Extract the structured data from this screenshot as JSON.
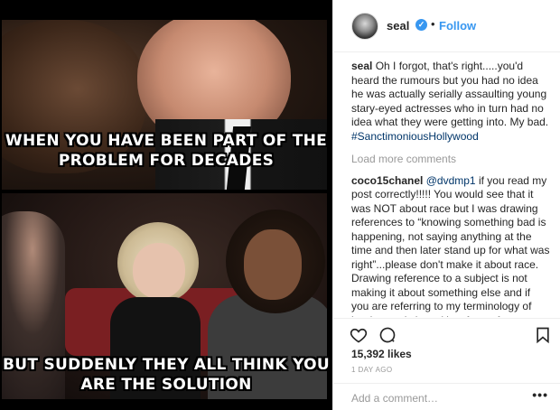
{
  "media": {
    "caption_top": "WHEN YOU HAVE BEEN PART OF THE PROBLEM FOR DECADES",
    "caption_bottom": "BUT SUDDENLY THEY ALL THINK YOU ARE THE SOLUTION"
  },
  "header": {
    "username": "seal",
    "verified_mark": "✓",
    "separator": "•",
    "follow_label": "Follow"
  },
  "comments": [
    {
      "user": "seal",
      "text": "Oh I forgot, that's right.....you'd heard the rumours but you had no idea he was actually serially assaulting young stary-eyed actresses who in turn had no idea what they were getting into. My bad.",
      "hashtag": "#SanctimoniousHollywood"
    },
    {
      "user": "coco15chanel",
      "mention": "@dvdmp1",
      "text": "if you read my post correctly!!!!! You would see that it was NOT about race but I was drawing references to “knowing something bad is happening, not saying anything at the time and then later stand up for what was right”...please don't make it about race. Drawing reference to a subject is not making it about something else and if you are referring to my terminology of brother and sister, it's a form of endearment...please read AGAIN!!!"
    }
  ],
  "load_more_label": "Load more comments",
  "actions": {
    "like_icon": "heart-icon",
    "comment_icon": "comment-bubble-icon",
    "save_icon": "bookmark-icon"
  },
  "likes": "15,392 likes",
  "time_ago": "1 DAY AGO",
  "add_comment_placeholder": "Add a comment…",
  "more_label": "•••",
  "colors": {
    "link_blue": "#3897f0",
    "hashtag_blue": "#003569",
    "muted_gray": "#999999",
    "text": "#262626"
  }
}
